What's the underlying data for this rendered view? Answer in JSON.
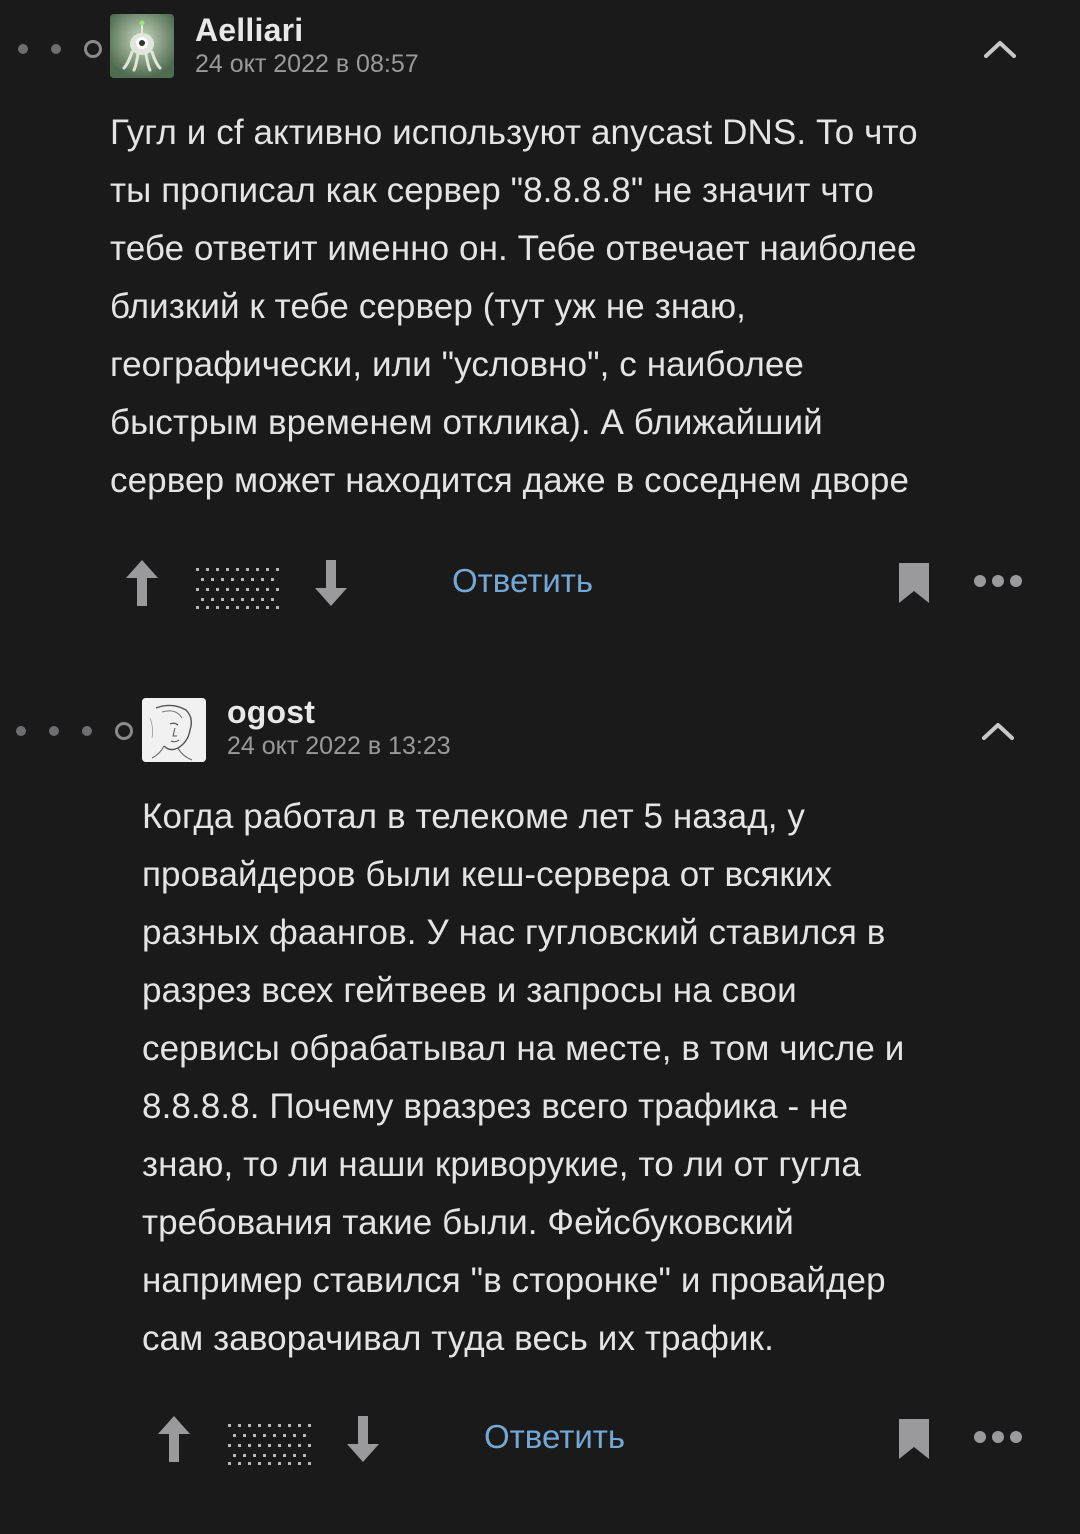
{
  "comments": [
    {
      "author": "Aelliari",
      "timestamp": "24 окт 2022 в 08:57",
      "lines": [
        "Гугл и cf активно используют anycast DNS. То что",
        "ты прописал как сервер \"8.8.8.8\" не значит что",
        "тебе ответит именно он. Тебе отвечает наиболее",
        "близкий к тебе сервер (тут уж не знаю,",
        "географически, или \"условно\", с наиболее",
        "быстрым временем отклика). А ближайший",
        "сервер может находится даже в соседнем дворе"
      ],
      "reply_label": "Ответить",
      "avatar_icon": "alien-avatar",
      "indent_level": 3
    },
    {
      "author": "ogost",
      "timestamp": "24 окт 2022 в 13:23",
      "lines": [
        "Когда работал в телекоме лет 5 назад, у",
        "провайдеров были кеш-сервера от всяких",
        "разных фаангов. У нас гугловский ставился в",
        "разрез всех гейтвеев и запросы на свои",
        "сервисы обрабатывал на месте, в том числе и",
        "8.8.8.8. Почему вразрез всего трафика - не",
        "знаю, то ли наши криворукие, то ли от гугла",
        "требования такие были. Фейсбуковский",
        "например ставился \"в сторонке\" и провайдер",
        "сам заворачивал туда весь их трафик."
      ],
      "reply_label": "Ответить",
      "avatar_icon": "sketch-portrait-avatar",
      "indent_level": 4
    }
  ],
  "colors": {
    "background": "#1a1a1b",
    "text": "#e4e4e4",
    "muted": "#9a9a9c",
    "link": "#74a8d4",
    "icon": "#9a9a9c"
  }
}
